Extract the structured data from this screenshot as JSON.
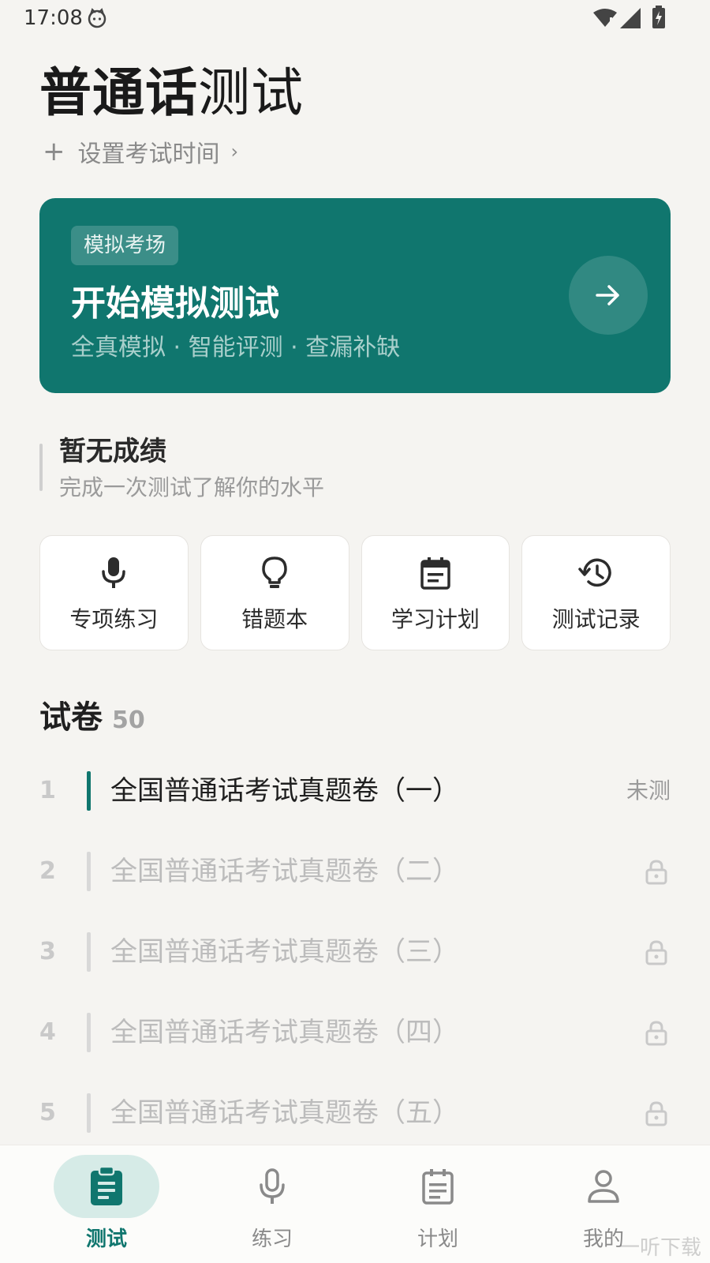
{
  "status_bar": {
    "time": "17:08"
  },
  "header": {
    "title_bold": "普通话",
    "title_light": "测试",
    "set_time": "设置考试时间"
  },
  "hero": {
    "badge": "模拟考场",
    "title": "开始模拟测试",
    "subtitle": "全真模拟 · 智能评测 · 查漏补缺"
  },
  "score": {
    "title": "暂无成绩",
    "subtitle": "完成一次测试了解你的水平"
  },
  "tiles": [
    {
      "label": "专项练习",
      "icon": "mic-icon"
    },
    {
      "label": "错题本",
      "icon": "lightbulb-icon"
    },
    {
      "label": "学习计划",
      "icon": "calendar-icon"
    },
    {
      "label": "测试记录",
      "icon": "history-icon"
    }
  ],
  "papers": {
    "title": "试卷",
    "count": "50",
    "items": [
      {
        "num": "1",
        "name": "全国普通话考试真题卷（一）",
        "status": "未测",
        "locked": false
      },
      {
        "num": "2",
        "name": "全国普通话考试真题卷（二）",
        "status": "",
        "locked": true
      },
      {
        "num": "3",
        "name": "全国普通话考试真题卷（三）",
        "status": "",
        "locked": true
      },
      {
        "num": "4",
        "name": "全国普通话考试真题卷（四）",
        "status": "",
        "locked": true
      },
      {
        "num": "5",
        "name": "全国普通话考试真题卷（五）",
        "status": "",
        "locked": true
      }
    ]
  },
  "nav": [
    {
      "label": "测试",
      "icon": "clipboard-icon",
      "active": true
    },
    {
      "label": "练习",
      "icon": "mic-icon",
      "active": false
    },
    {
      "label": "计划",
      "icon": "calendar-icon",
      "active": false
    },
    {
      "label": "我的",
      "icon": "person-icon",
      "active": false
    }
  ],
  "watermark": "一听下载",
  "colors": {
    "accent": "#10766e",
    "accent_light": "#d6ebe7",
    "background": "#f5f4f1"
  }
}
